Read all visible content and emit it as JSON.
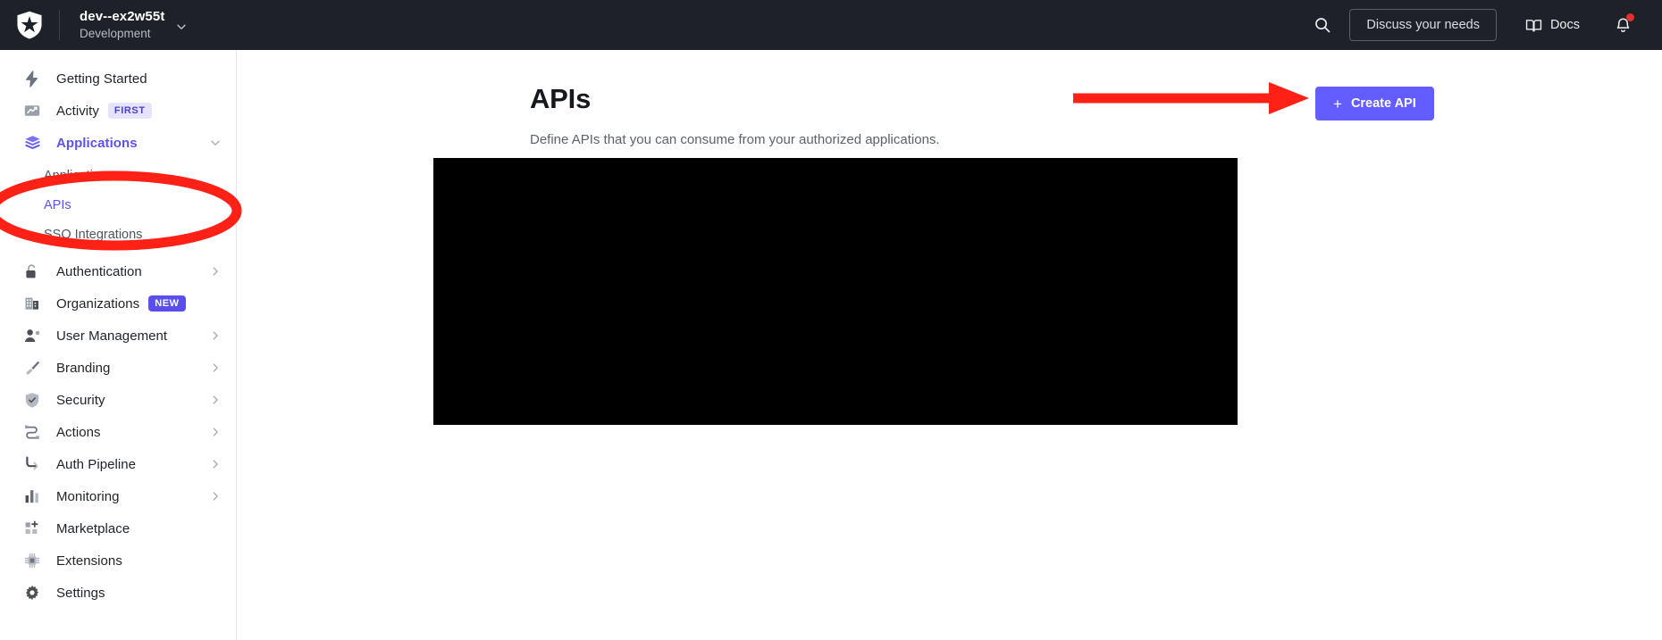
{
  "topbar": {
    "logo_icon": "auth0-shield-logo",
    "tenant": {
      "name": "dev--ex2w55t",
      "environment": "Development",
      "chevron_icon": "chevron-down-icon"
    },
    "search_icon": "search-icon",
    "discuss_label": "Discuss your needs",
    "docs_label": "Docs",
    "docs_icon": "book-icon",
    "notifications_icon": "bell-icon",
    "notifications_has_unread": true
  },
  "sidebar": {
    "items": [
      {
        "label": "Getting Started",
        "icon": "bolt-icon",
        "expandable": false,
        "active": false
      },
      {
        "label": "Activity",
        "icon": "activity-chart-icon",
        "badge": "FIRST",
        "badge_style": "first",
        "expandable": false,
        "active": false
      },
      {
        "label": "Applications",
        "icon": "layers-icon",
        "expandable": true,
        "expanded": true,
        "active": true,
        "children": [
          {
            "label": "Applications",
            "active": false
          },
          {
            "label": "APIs",
            "active": true
          },
          {
            "label": "SSO Integrations",
            "active": false
          }
        ]
      },
      {
        "label": "Authentication",
        "icon": "lock-open-icon",
        "expandable": true,
        "active": false
      },
      {
        "label": "Organizations",
        "icon": "building-icon",
        "badge": "NEW",
        "badge_style": "new",
        "expandable": false,
        "active": false
      },
      {
        "label": "User Management",
        "icon": "user-gear-icon",
        "expandable": true,
        "active": false
      },
      {
        "label": "Branding",
        "icon": "paintbrush-icon",
        "expandable": true,
        "active": false
      },
      {
        "label": "Security",
        "icon": "shield-check-icon",
        "expandable": true,
        "active": false
      },
      {
        "label": "Actions",
        "icon": "flow-nodes-icon",
        "expandable": true,
        "active": false
      },
      {
        "label": "Auth Pipeline",
        "icon": "pipeline-arrow-icon",
        "expandable": true,
        "active": false
      },
      {
        "label": "Monitoring",
        "icon": "bar-chart-icon",
        "expandable": true,
        "active": false
      },
      {
        "label": "Marketplace",
        "icon": "grid-plus-icon",
        "expandable": false,
        "active": false
      },
      {
        "label": "Extensions",
        "icon": "chip-icon",
        "expandable": false,
        "active": false
      },
      {
        "label": "Settings",
        "icon": "gear-icon",
        "expandable": false,
        "active": false
      }
    ]
  },
  "main": {
    "title": "APIs",
    "subtitle": "Define APIs that you can consume from your authorized applications.",
    "create_button": {
      "label": "Create API",
      "icon": "plus-icon"
    },
    "content_area": {
      "state": "redacted",
      "label": ""
    }
  },
  "annotations": {
    "color": "#FF2116",
    "arrow": {
      "name": "red-arrow-to-create-api"
    },
    "ellipse": {
      "name": "red-ellipse-around-apis-nav"
    }
  },
  "colors": {
    "brand_purple": "#635DFF",
    "topbar_dark": "#1E2228",
    "annotation_red": "#FF2116",
    "badge_new_bg": "#5A4FEC",
    "badge_first_bg": "#E5E3FD"
  }
}
